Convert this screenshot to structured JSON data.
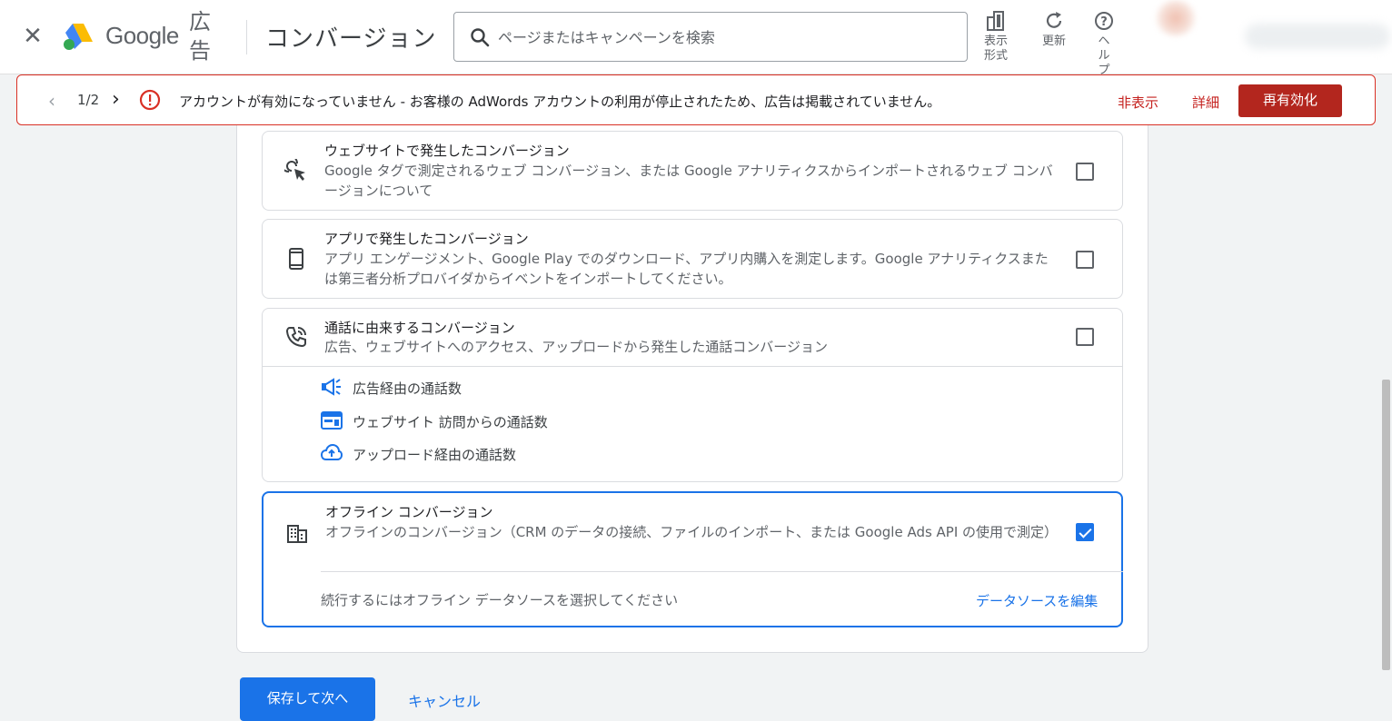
{
  "topbar": {
    "brand": "Google",
    "brand_sub": "広告",
    "page_title": "コンバージョン",
    "search_placeholder": "ページまたはキャンペーンを検索",
    "tools": [
      {
        "label": "表示形式",
        "icon": "view-format-icon"
      },
      {
        "label": "更新",
        "icon": "refresh-icon"
      },
      {
        "label": "ヘルプ",
        "icon": "help-icon"
      }
    ]
  },
  "alert": {
    "pager": "1/2",
    "message": "アカウントが有効になっていません - お客様の AdWords アカウントの利用が停止されたため、広告は掲載されていません。",
    "hide": "非表示",
    "detail": "詳細",
    "reenable": "再有効化"
  },
  "cards": {
    "website": {
      "title": "ウェブサイトで発生したコンバージョン",
      "desc": "Google タグで測定されるウェブ コンバージョン、または Google アナリティクスからインポートされるウェブ コンバージョンについて",
      "checked": false
    },
    "app": {
      "title": "アプリで発生したコンバージョン",
      "desc": "アプリ エンゲージメント、Google Play でのダウンロード、アプリ内購入を測定します。Google アナリティクスまたは第三者分析プロバイダからイベントをインポートしてください。",
      "checked": false
    },
    "calls": {
      "title": "通話に由来するコンバージョン",
      "desc": "広告、ウェブサイトへのアクセス、アップロードから発生した通話コンバージョン",
      "checked": false,
      "items": [
        {
          "label": "広告経由の通話数",
          "icon": "megaphone-icon"
        },
        {
          "label": "ウェブサイト 訪問からの通話数",
          "icon": "web-icon"
        },
        {
          "label": "アップロード経由の通話数",
          "icon": "cloud-upload-icon"
        }
      ]
    },
    "offline": {
      "title": "オフライン コンバージョン",
      "desc": "オフラインのコンバージョン（CRM のデータの接続、ファイルのインポート、または Google Ads API の使用で測定）",
      "checked": true,
      "note": "続行するにはオフライン データソースを選択してください",
      "edit_link": "データソースを編集"
    }
  },
  "footer": {
    "save": "保存して次へ",
    "cancel": "キャンセル"
  },
  "colors": {
    "accent": "#1a73e8",
    "error": "#d93025",
    "reenable_bg": "#b3261e"
  }
}
